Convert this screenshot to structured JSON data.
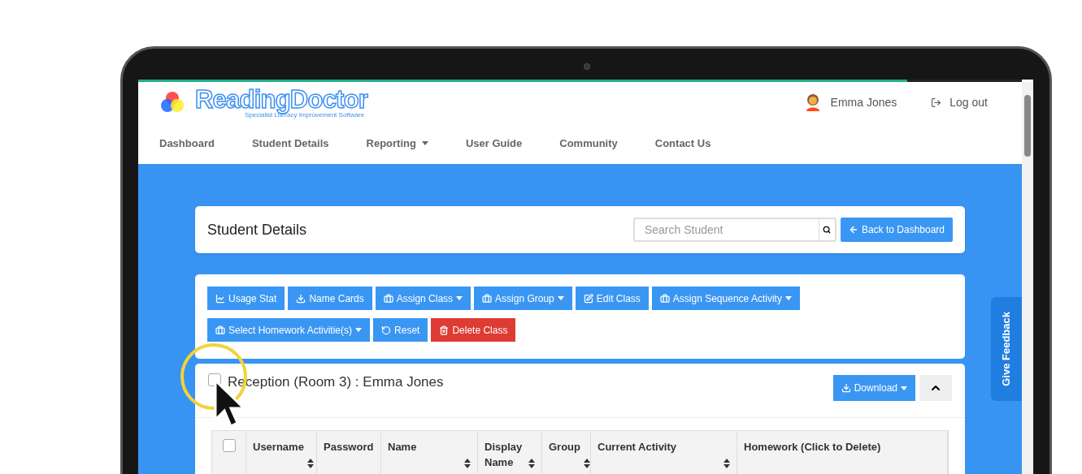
{
  "loading_bar": {
    "level": 0.87
  },
  "logo": {
    "name": "ReadingDoctor",
    "tagline": "Specialist Literacy Improvement Software"
  },
  "user": {
    "name": "Emma Jones"
  },
  "logout": {
    "label": "Log out"
  },
  "nav": [
    {
      "label": "Dashboard",
      "dropdown": false
    },
    {
      "label": "Student Details",
      "dropdown": false
    },
    {
      "label": "Reporting",
      "dropdown": true
    },
    {
      "label": "User Guide",
      "dropdown": false
    },
    {
      "label": "Community",
      "dropdown": false
    },
    {
      "label": "Contact Us",
      "dropdown": false
    }
  ],
  "page_header": {
    "title": "Student Details",
    "search": {
      "placeholder": "Search Student"
    },
    "back_button": "Back to Dashboard"
  },
  "toolbar": [
    {
      "label": "Usage Stat",
      "dropdown": false,
      "kind": "primary"
    },
    {
      "label": "Name Cards",
      "dropdown": false,
      "kind": "primary"
    },
    {
      "label": "Assign Class",
      "dropdown": true,
      "kind": "primary"
    },
    {
      "label": "Assign Group",
      "dropdown": true,
      "kind": "primary"
    },
    {
      "label": "Edit Class",
      "dropdown": false,
      "kind": "primary"
    },
    {
      "label": "Assign Sequence Activity",
      "dropdown": true,
      "kind": "primary"
    },
    {
      "label": "Select Homework Activitie(s)",
      "dropdown": true,
      "kind": "primary"
    },
    {
      "label": "Reset",
      "dropdown": false,
      "kind": "primary"
    },
    {
      "label": "Delete Class",
      "dropdown": false,
      "kind": "danger"
    }
  ],
  "class_panel": {
    "title": "Reception (Room 3) : Emma Jones",
    "checked": false,
    "download": "Download",
    "expanded": true,
    "table": {
      "all_checked": false,
      "columns": [
        {
          "label": "Username",
          "sortable": true
        },
        {
          "label": "Password",
          "sortable": false
        },
        {
          "label": "Name",
          "sortable": true
        },
        {
          "label": "Display Name",
          "sortable": true
        },
        {
          "label": "Group",
          "sortable": true
        },
        {
          "label": "Current Activity",
          "sortable": true
        },
        {
          "label": "Homework (Click to Delete)",
          "sortable": false
        }
      ]
    }
  },
  "feedback_tab": "Give Feedback"
}
